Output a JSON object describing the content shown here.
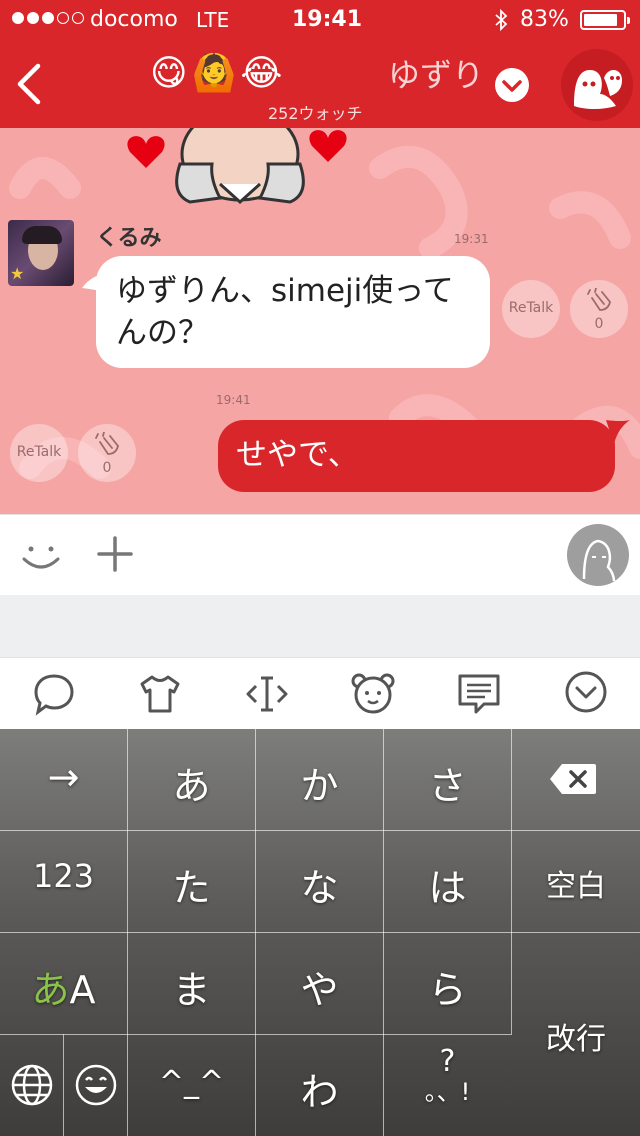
{
  "status_bar": {
    "carrier": "docomo",
    "network": "LTE",
    "time": "19:41",
    "battery_percent": "83%",
    "battery_level": 0.83,
    "signal_dots_filled": 3,
    "signal_dots_total": 5
  },
  "header": {
    "back_icon": "chevron-left-icon",
    "emojis": [
      "😋",
      "🙆",
      "😂"
    ],
    "title": "ゆずり",
    "watch_count": "252ウォッチ",
    "dropdown_icon": "chevron-down-icon",
    "room_icon": "ghost-icon",
    "accent_color": "#d9262a"
  },
  "chat": {
    "background_color": "#f6a5a5",
    "messages": [
      {
        "sender": "くるみ",
        "time": "19:31",
        "text_line1": "ゆずりん、simeji使って",
        "text_line2": "んの？",
        "retalk_label": "ReTalk",
        "clap_count": "0"
      },
      {
        "time": "19:41",
        "text": "せやで、",
        "retalk_label": "ReTalk",
        "clap_count": "0"
      }
    ]
  },
  "input_bar": {
    "smiley_icon": "smiley-icon",
    "plus_icon": "plus-icon",
    "avatar_icon": "avatar-icon"
  },
  "keyboard_toolbar": {
    "icons": [
      "speech-bubble-icon",
      "tshirt-icon",
      "cursor-icon",
      "bear-face-icon",
      "message-box-icon",
      "chevron-down-circle-icon"
    ]
  },
  "keyboard": {
    "keys_row1": [
      "→",
      "あ",
      "か",
      "さ"
    ],
    "keys_row2": [
      "123",
      "た",
      "な",
      "は",
      "空白"
    ],
    "keys_row3_mode_a": "あ",
    "keys_row3_mode_b": "A",
    "keys_row3": [
      "ま",
      "や",
      "ら"
    ],
    "keys_row4": [
      "^_^",
      "わ"
    ],
    "punct_top": "?",
    "punct_bottom": "。、!",
    "enter_label": "改行",
    "mode_color": "#8bc34a"
  }
}
